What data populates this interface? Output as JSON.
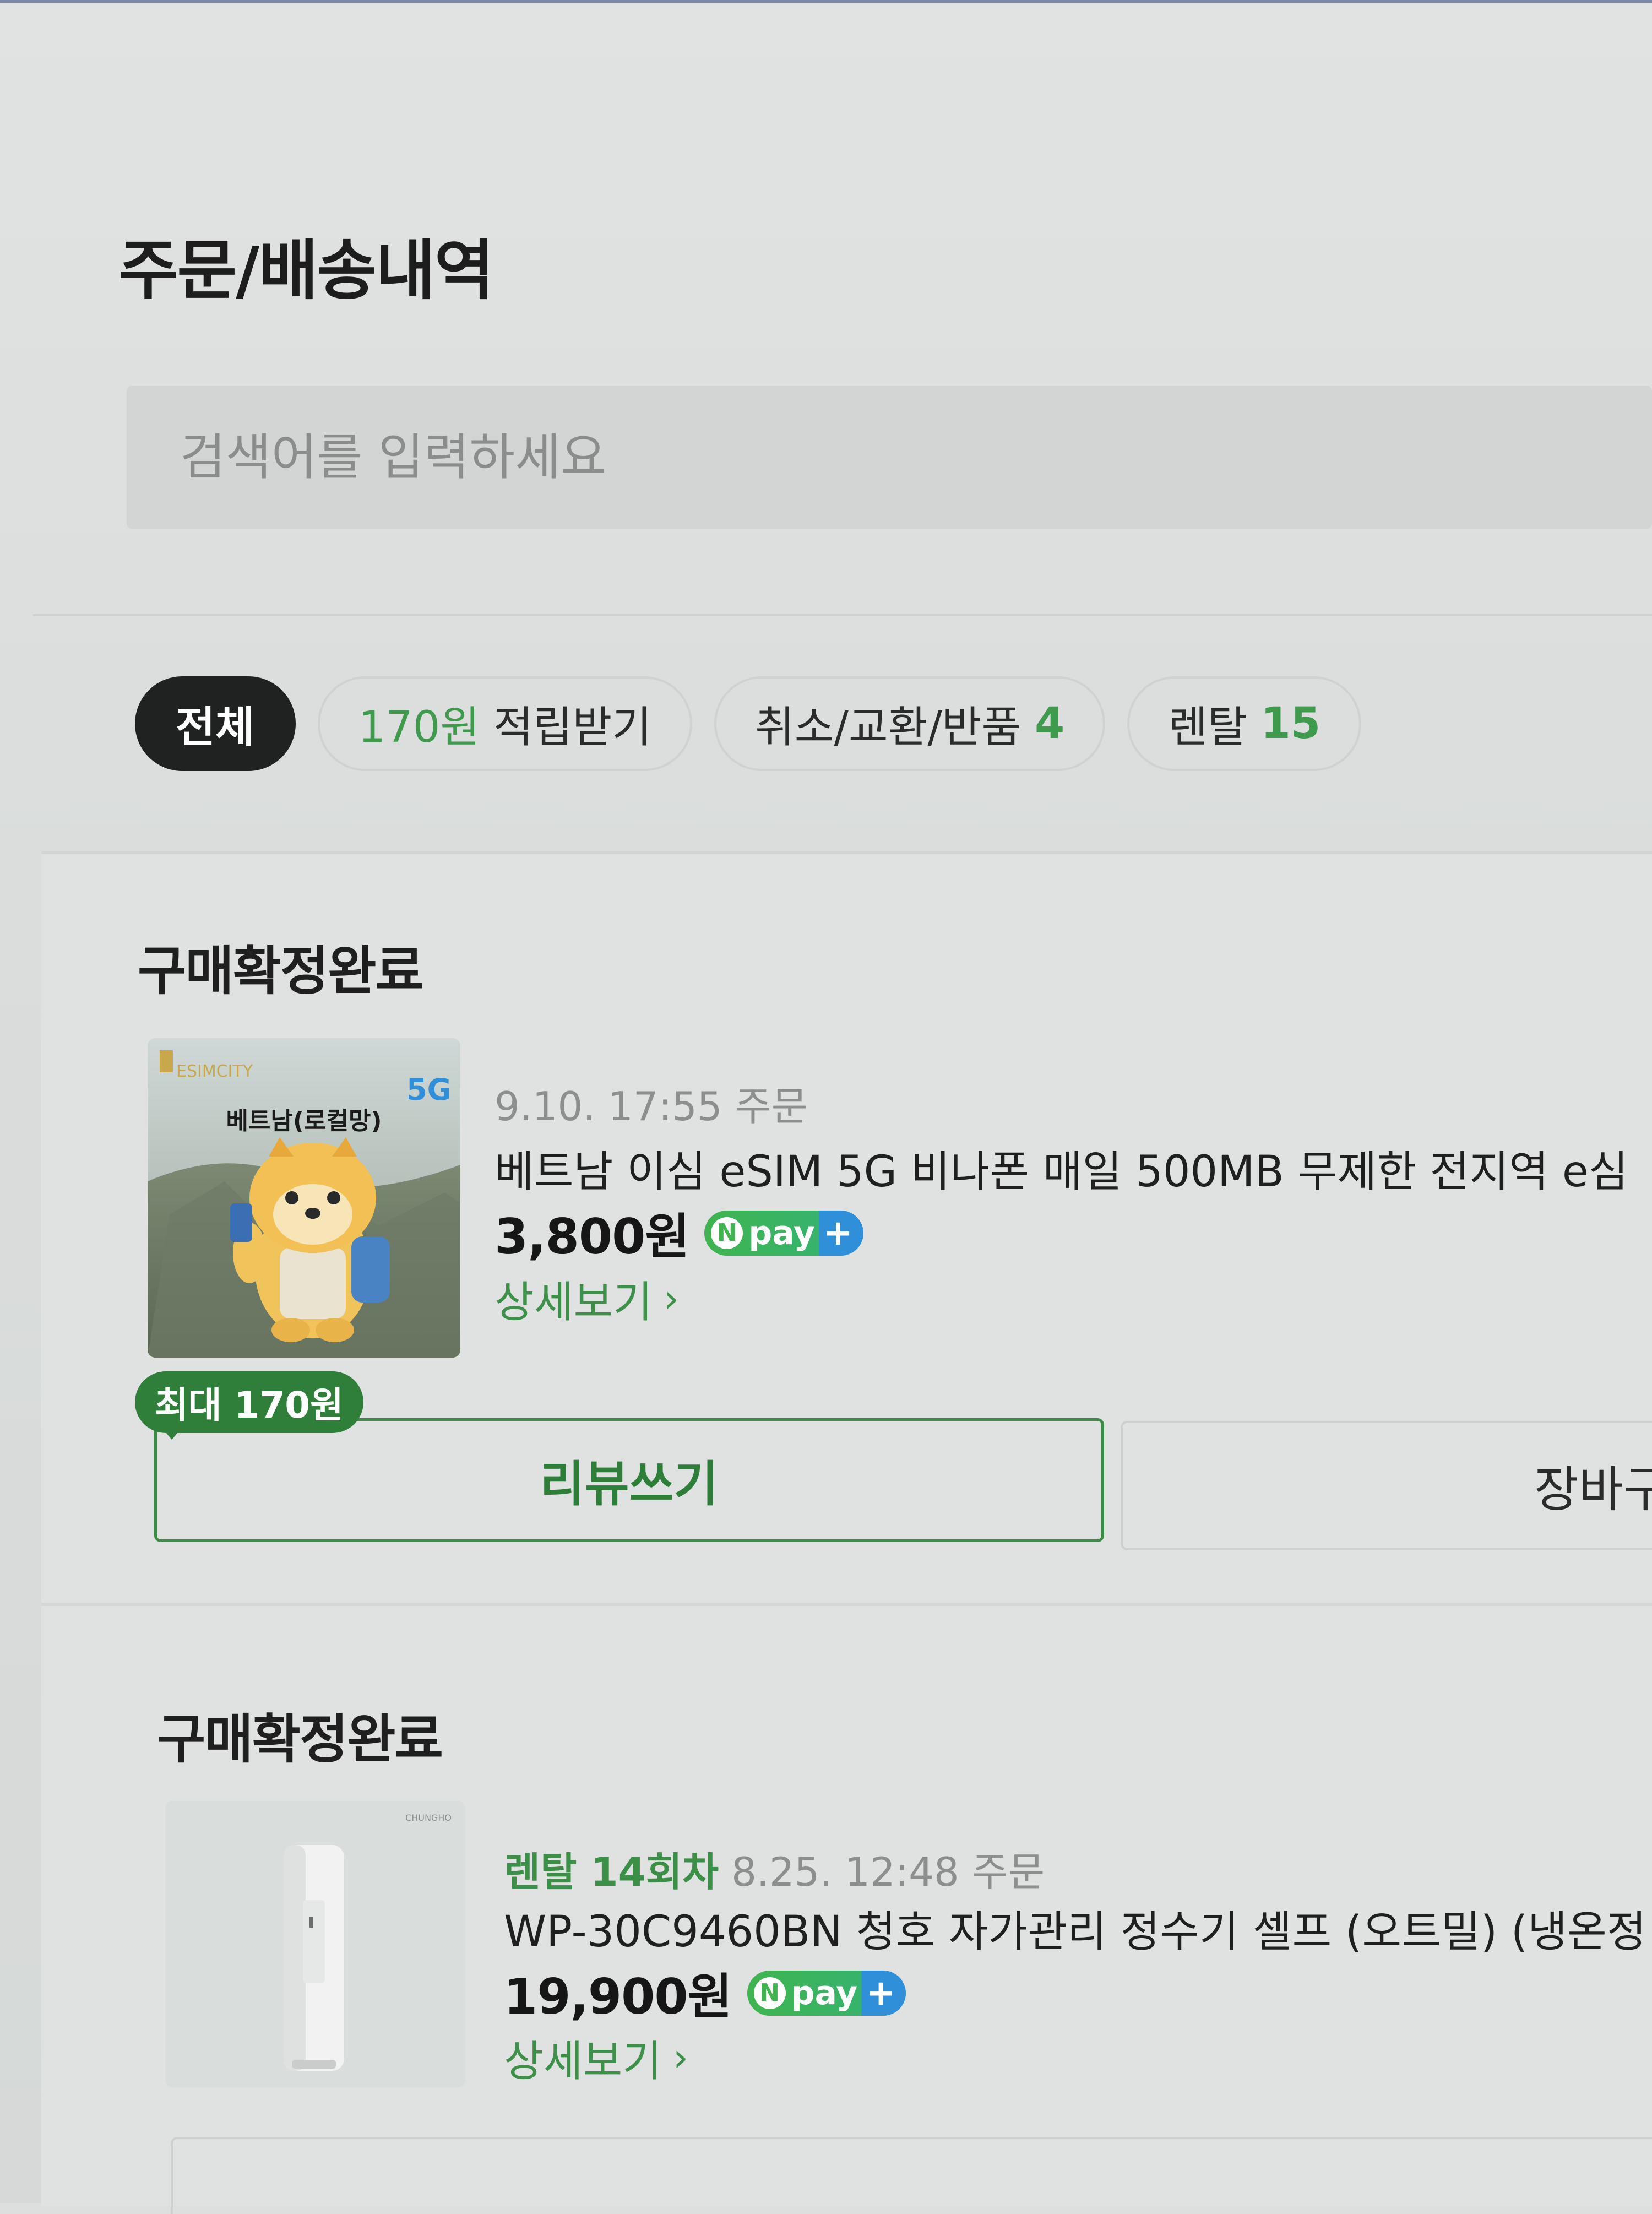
{
  "page": {
    "title": "주문/배송내역",
    "search_placeholder": "검색어를 입력하세요"
  },
  "filters": [
    {
      "label": "전체",
      "active": true
    },
    {
      "label_pre": "170원",
      "label_post": " 적립받기"
    },
    {
      "label": "취소/교환/반품 ",
      "count": "4"
    },
    {
      "label": "렌탈 ",
      "count": "15"
    }
  ],
  "orders": [
    {
      "status": "구매확정완료",
      "thumb_brand": "ESIMCITY",
      "thumb_badge": "5G",
      "thumb_title": "베트남(로컬망)",
      "order_meta": "9.10. 17:55 주문",
      "product_name": "베트남 이심 eSIM 5G 비나폰 매일 500MB 무제한 전지역 e심",
      "price": "3,800원",
      "npay": "pay",
      "detail_link": "상세보기",
      "review_badge": "최대 170원",
      "review_button": "리뷰쓰기",
      "cart_button": "장바구니"
    },
    {
      "status": "구매확정완료",
      "thumb_brand": "CHUNGHO",
      "rental_tag": "렌탈 14회차",
      "order_meta": "8.25. 12:48 주문",
      "product_name": "WP-30C9460BN 청호 자가관리 정수기 셀프 (오트밀) (냉온정",
      "price": "19,900원",
      "npay": "pay",
      "detail_link": "상세보기"
    }
  ]
}
